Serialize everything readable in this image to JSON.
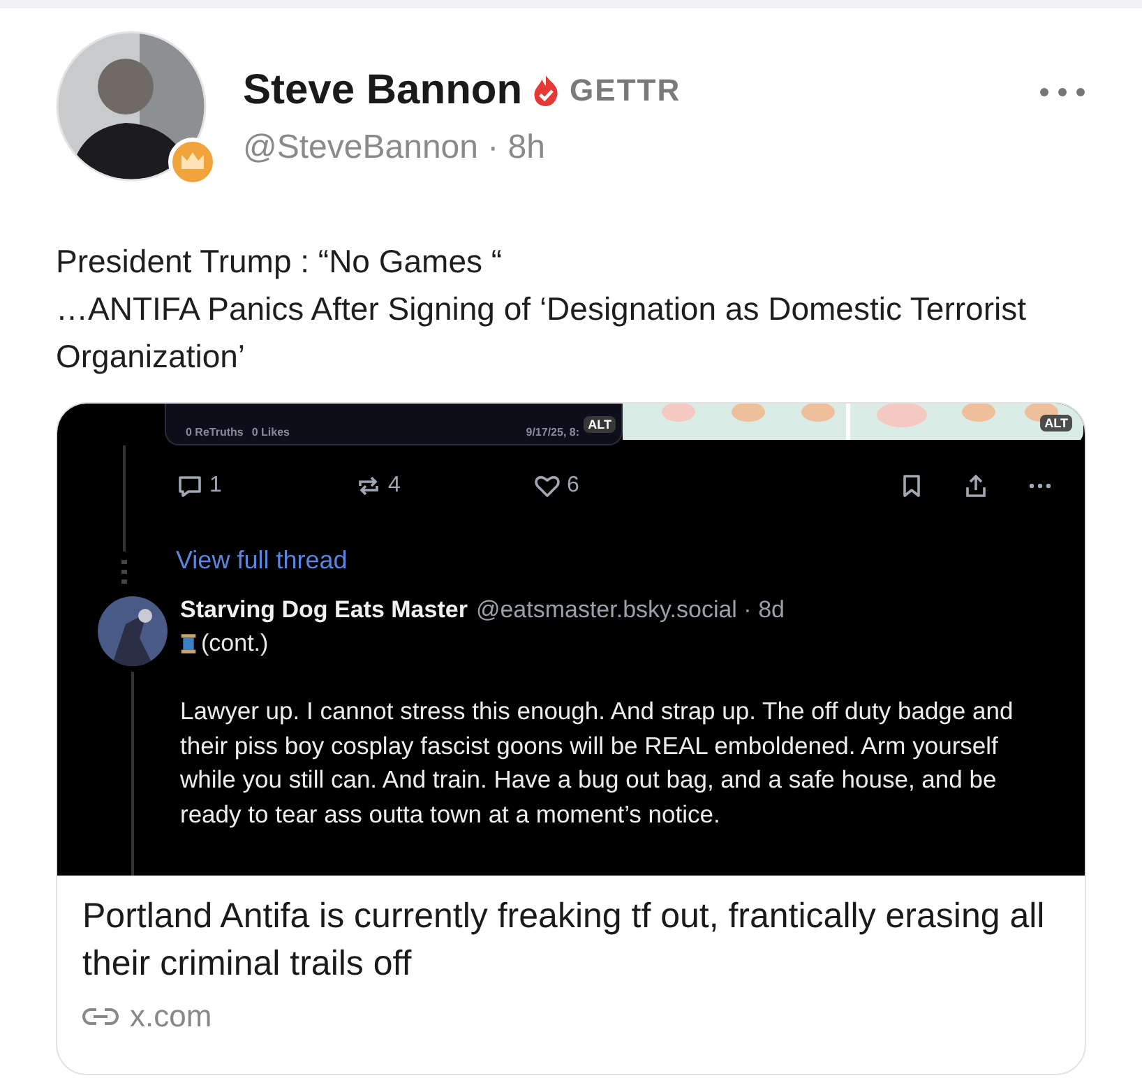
{
  "post": {
    "author": "Steve Bannon",
    "platform": "GETTR",
    "handle_line": "@SteveBannon · 8h",
    "text_lines": [
      "President Trump : “No Games “",
      "…ANTIFA Panics After Signing of ‘Designation as Domestic Terrorist Organization’"
    ]
  },
  "embed": {
    "quoted_image": {
      "retruths": "0 ReTruths",
      "likes": "0 Likes",
      "timestamp": "9/17/25, 8:",
      "alt": "ALT"
    },
    "second_image": {
      "kind": "picture",
      "alt": "ALT"
    },
    "actions": [
      {
        "kind": "reply",
        "count": "1"
      },
      {
        "kind": "repost",
        "count": "4"
      },
      {
        "kind": "like",
        "count": "6"
      }
    ],
    "view_thread": "View full thread",
    "reply": {
      "author": "Starving Dog Eats Master",
      "handle_line": "@eatsmaster.bsky.social · 8d",
      "tag": "(cont.)",
      "text": "Lawyer up. I cannot stress this enough. And strap up. The off duty badge and their piss boy cosplay fascist goons will be REAL emboldened. Arm yourself while you still can. And train. Have a bug out bag, and a safe house, and be ready to tear ass outta town at a moment’s notice."
    }
  },
  "link": {
    "title": "Portland Antifa is currently freaking tf out, frantically erasing all their criminal trails off",
    "domain": "x.com"
  }
}
